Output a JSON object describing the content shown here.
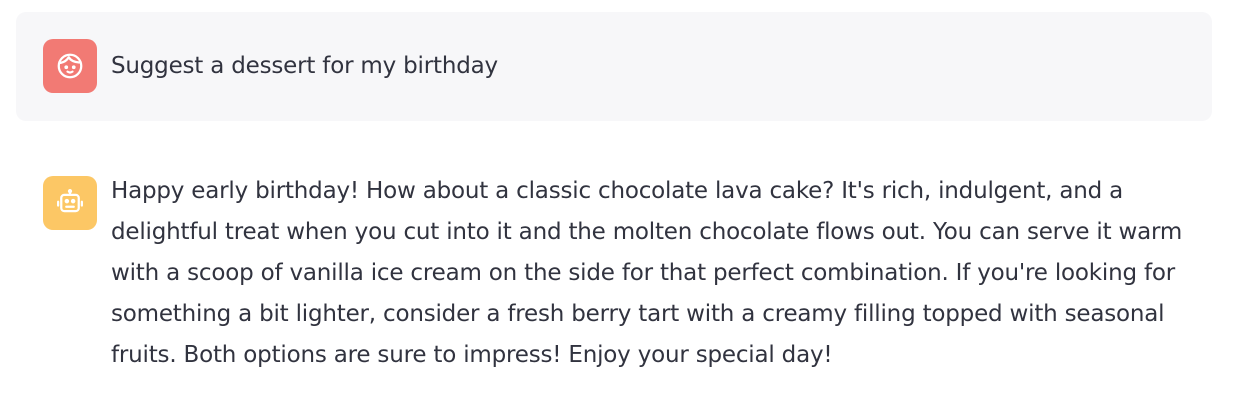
{
  "chat": {
    "messages": [
      {
        "role": "user",
        "avatar_icon": "user-face-icon",
        "avatar_color": "#f27a74",
        "text": "Suggest a dessert for my birthday"
      },
      {
        "role": "assistant",
        "avatar_icon": "robot-icon",
        "avatar_color": "#fcc765",
        "text": "Happy early birthday! How about a classic chocolate lava cake? It's rich, indulgent, and a delightful treat when you cut into it and the molten chocolate flows out. You can serve it warm with a scoop of vanilla ice cream on the side for that perfect combination. If you're looking for something a bit lighter, consider a fresh berry tart with a creamy filling topped with seasonal fruits. Both options are sure to impress! Enjoy your special day!"
      }
    ]
  },
  "colors": {
    "user_bubble_bg": "#f7f7f9",
    "text": "#31333f"
  }
}
